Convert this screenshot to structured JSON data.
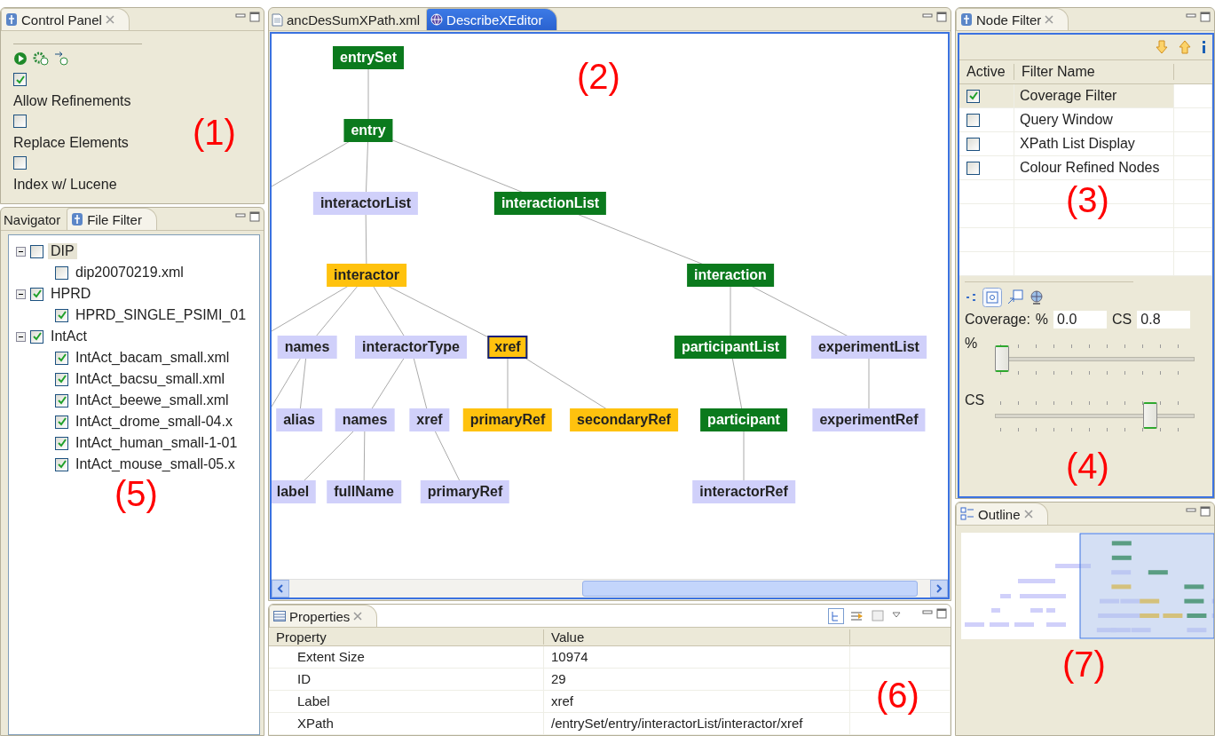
{
  "control_panel": {
    "title": "Control Panel",
    "options": [
      {
        "label": "Allow Refinements",
        "checked": true
      },
      {
        "label": "Replace Elements",
        "checked": false
      },
      {
        "label": "Index w/ Lucene",
        "checked": false
      }
    ],
    "annotation": "(1)"
  },
  "file_filter": {
    "tabs": [
      {
        "label": "Navigator",
        "selected": false
      },
      {
        "label": "File Filter",
        "selected": true
      }
    ],
    "tree": [
      {
        "label": "DIP",
        "checked": false,
        "selected": true,
        "expanded": true,
        "children": [
          {
            "label": "dip20070219.xml",
            "checked": false,
            "selected": false
          }
        ]
      },
      {
        "label": "HPRD",
        "checked": true,
        "selected": false,
        "expanded": true,
        "children": [
          {
            "label": "HPRD_SINGLE_PSIMI_01",
            "checked": true,
            "selected": false
          }
        ]
      },
      {
        "label": "IntAct",
        "checked": true,
        "selected": false,
        "expanded": true,
        "children": [
          {
            "label": "IntAct_bacam_small.xml",
            "checked": true,
            "selected": false
          },
          {
            "label": "IntAct_bacsu_small.xml",
            "checked": true,
            "selected": false
          },
          {
            "label": "IntAct_beewe_small.xml",
            "checked": true,
            "selected": false
          },
          {
            "label": "IntAct_drome_small-04.x",
            "checked": true,
            "selected": false
          },
          {
            "label": "IntAct_human_small-1-01",
            "checked": true,
            "selected": false
          },
          {
            "label": "IntAct_mouse_small-05.x",
            "checked": true,
            "selected": false
          }
        ]
      }
    ],
    "annotation": "(5)"
  },
  "editor": {
    "tabs": [
      {
        "label": "ancDesSumXPath.xml",
        "selected": false
      },
      {
        "label": "DescribeXEditor",
        "selected": true
      }
    ],
    "graph": [
      {
        "label": "entrySet",
        "color": "#0b7a1d",
        "selected": false,
        "children": [
          {
            "label": "entry",
            "color": "#0b7a1d",
            "selected": false,
            "children": [
              {
                "label": "interactorList",
                "color": "#d0d0fa",
                "selected": false,
                "children": [
                  {
                    "label": "interactor",
                    "color": "#ffc20e",
                    "selected": false,
                    "children": [
                      {
                        "label": "names",
                        "color": "#d0d0fa",
                        "selected": false,
                        "children": [
                          {
                            "label": "alias",
                            "color": "#d0d0fa",
                            "selected": false
                          }
                        ]
                      },
                      {
                        "label": "interactorType",
                        "color": "#d0d0fa",
                        "selected": false,
                        "children": [
                          {
                            "label": "names",
                            "color": "#d0d0fa",
                            "selected": false,
                            "children": [
                              {
                                "label": "label",
                                "color": "#d0d0fa",
                                "selected": false
                              },
                              {
                                "label": "fullName",
                                "color": "#d0d0fa",
                                "selected": false
                              }
                            ]
                          },
                          {
                            "label": "xref",
                            "color": "#d0d0fa",
                            "selected": false,
                            "children": [
                              {
                                "label": "primaryRef",
                                "color": "#d0d0fa",
                                "selected": false
                              }
                            ]
                          }
                        ]
                      },
                      {
                        "label": "xref",
                        "color": "#ffc20e",
                        "selected": true,
                        "children": [
                          {
                            "label": "primaryRef",
                            "color": "#ffc20e",
                            "selected": false
                          },
                          {
                            "label": "secondaryRef",
                            "color": "#ffc20e",
                            "selected": false
                          }
                        ]
                      }
                    ]
                  }
                ]
              },
              {
                "label": "interactionList",
                "color": "#0b7a1d",
                "selected": false,
                "children": [
                  {
                    "label": "interaction",
                    "color": "#0b7a1d",
                    "selected": false,
                    "children": [
                      {
                        "label": "participantList",
                        "color": "#0b7a1d",
                        "selected": false,
                        "children": [
                          {
                            "label": "participant",
                            "color": "#0b7a1d",
                            "selected": false,
                            "children": [
                              {
                                "label": "interactorRef",
                                "color": "#d0d0fa",
                                "selected": false
                              }
                            ]
                          }
                        ]
                      },
                      {
                        "label": "experimentList",
                        "color": "#d0d0fa",
                        "selected": false,
                        "children": [
                          {
                            "label": "experimentRef",
                            "color": "#d0d0fa",
                            "selected": false
                          }
                        ]
                      }
                    ]
                  }
                ]
              }
            ]
          }
        ]
      }
    ],
    "annotation": "(2)"
  },
  "properties": {
    "title": "Properties",
    "columns": [
      "Property",
      "Value"
    ],
    "rows": [
      {
        "property": "Extent Size",
        "value": "10974"
      },
      {
        "property": "ID",
        "value": "29"
      },
      {
        "property": "Label",
        "value": "xref"
      },
      {
        "property": "XPath",
        "value": "/entrySet/entry/interactorList/interactor/xref"
      }
    ],
    "annotation": "(6)"
  },
  "node_filter": {
    "title": "Node Filter",
    "columns": [
      "Active",
      "Filter Name"
    ],
    "rows": [
      {
        "active": true,
        "name": "Coverage Filter",
        "selected": true
      },
      {
        "active": false,
        "name": "Query Window",
        "selected": false
      },
      {
        "active": false,
        "name": "XPath List Display",
        "selected": false
      },
      {
        "active": false,
        "name": "Colour Refined Nodes",
        "selected": false
      }
    ],
    "coverage_label": "Coverage:",
    "percent_label": "%",
    "percent_value": "0.0",
    "cs_label": "CS",
    "cs_value": "0.8",
    "sliders": [
      {
        "label": "%",
        "level": 0.0
      },
      {
        "label": "CS",
        "level": 0.8
      }
    ],
    "annotations": [
      "(3)",
      "(4)"
    ]
  },
  "outline": {
    "title": "Outline",
    "annotation": "(7)"
  }
}
